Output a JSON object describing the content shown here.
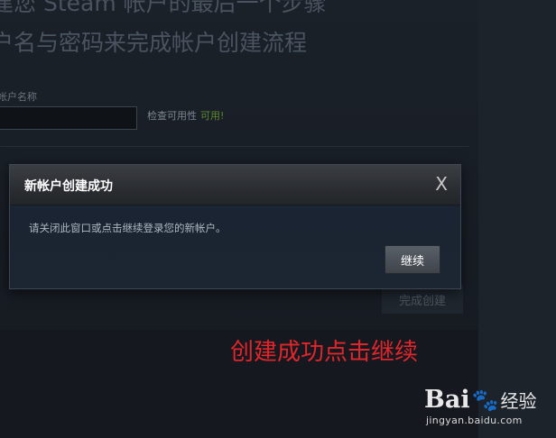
{
  "background": {
    "title_line1": "建您 Steam 帐户的最后一个步骤",
    "title_line2": "户名与密码来完成帐户创建流程",
    "account_label": "帐户名称",
    "check_label": "检查可用性",
    "available_text": "可用!",
    "finish_button": "完成创建"
  },
  "dialog": {
    "title": "新帐户创建成功",
    "close_symbol": "X",
    "message": "请关闭此窗口或点击继续登录您的新帐户。",
    "continue_label": "继续"
  },
  "annotation": "创建成功点击继续",
  "watermark": {
    "logo_text": "Bai",
    "paw_glyph": "🐾",
    "logo_suffix": "经验",
    "url": "jingyan.baidu.com"
  },
  "colors": {
    "annotation": "#e0262b",
    "available": "#5c8a2f"
  }
}
